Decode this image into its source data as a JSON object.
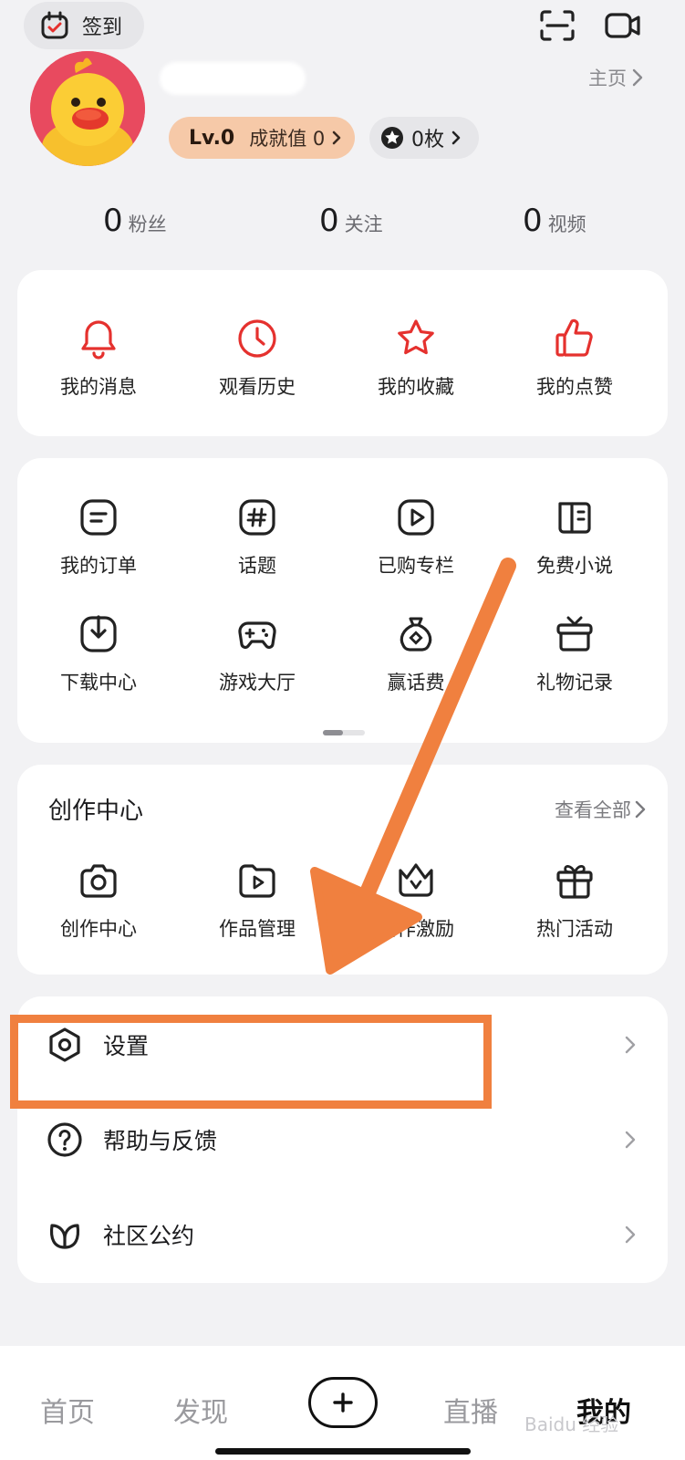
{
  "topbar": {
    "checkin_label": "签到"
  },
  "profile": {
    "home_link": "主页",
    "level": "Lv.0",
    "achievement": "成就值 0",
    "coins": "0枚"
  },
  "stats": [
    {
      "num": "0",
      "label": "粉丝"
    },
    {
      "num": "0",
      "label": "关注"
    },
    {
      "num": "0",
      "label": "视频"
    }
  ],
  "quick_actions": [
    "我的消息",
    "观看历史",
    "我的收藏",
    "我的点赞"
  ],
  "services": [
    "我的订单",
    "话题",
    "已购专栏",
    "免费小说",
    "下载中心",
    "游戏大厅",
    "赢话费",
    "礼物记录"
  ],
  "creator": {
    "title": "创作中心",
    "see_all": "查看全部",
    "items": [
      "创作中心",
      "作品管理",
      "创作激励",
      "热门活动"
    ]
  },
  "menu": [
    "设置",
    "帮助与反馈",
    "社区公约"
  ],
  "bottom_nav": {
    "home": "首页",
    "discover": "发现",
    "live": "直播",
    "me": "我的",
    "watermark": "Baidu 经验"
  },
  "colors": {
    "accent_red": "#e5312e",
    "annotation_orange": "#f0803f"
  }
}
